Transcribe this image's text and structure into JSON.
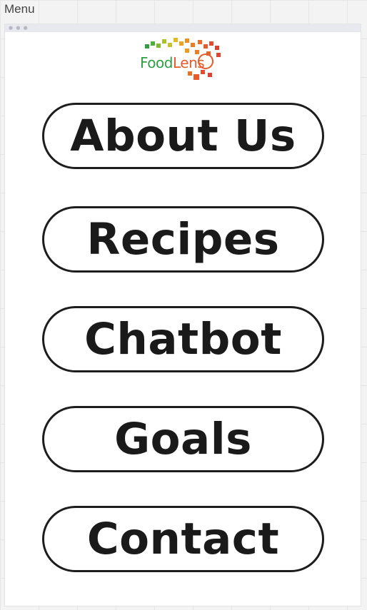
{
  "frame": {
    "label": "Menu"
  },
  "logo": {
    "word_part1": "Food",
    "word_part2": "Lens",
    "icon": "foodlens-logo-icon"
  },
  "menu": {
    "items": [
      {
        "label": "About Us"
      },
      {
        "label": "Recipes"
      },
      {
        "label": "Chatbot"
      },
      {
        "label": "Goals"
      },
      {
        "label": "Contact"
      }
    ]
  },
  "colors": {
    "button_border": "#1d1d1d",
    "button_text": "#1a1a1a",
    "logo_green": "#2e9f43",
    "logo_orange": "#e85a2a",
    "canvas_bg": "#f3f3f3"
  }
}
